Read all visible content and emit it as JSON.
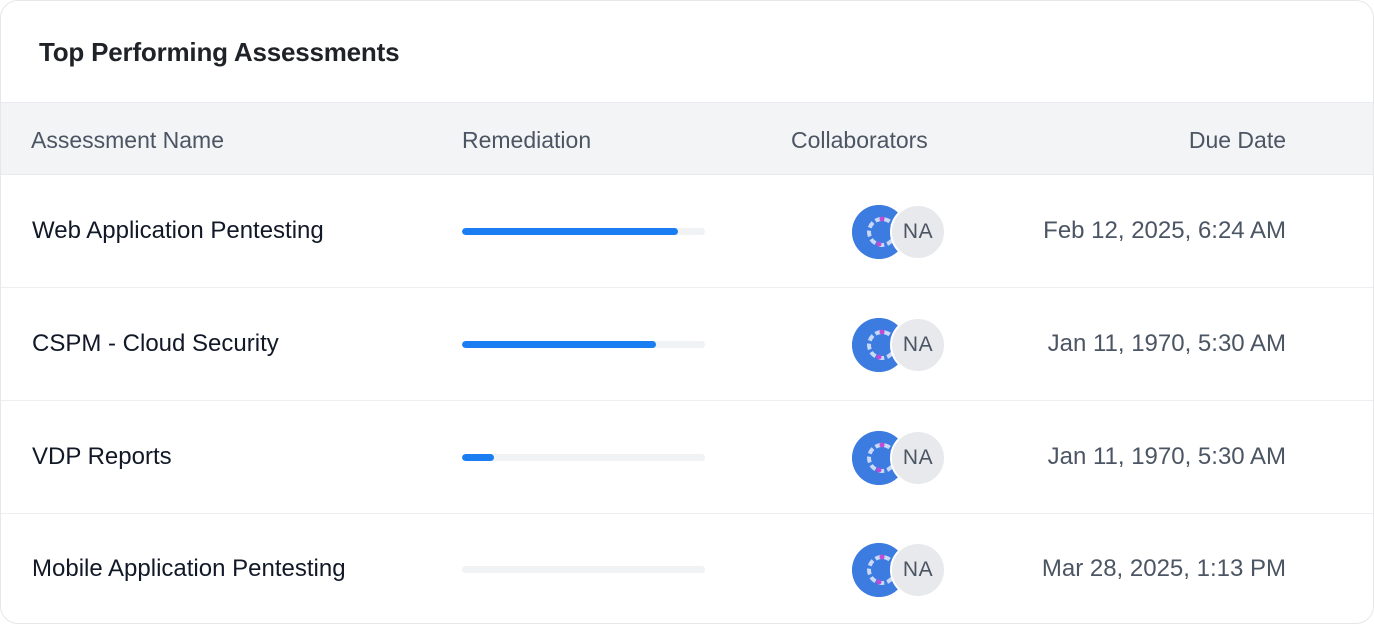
{
  "widget": {
    "title": "Top Performing Assessments"
  },
  "table": {
    "headers": {
      "name": "Assessment Name",
      "remediation": "Remediation",
      "collaborators": "Collaborators",
      "due_date": "Due Date"
    },
    "rows": [
      {
        "name": "Web Application Pentesting",
        "remediation_fraction": 0.89,
        "collaborator_initials": "NA",
        "due_date": "Feb 12, 2025, 6:24 AM"
      },
      {
        "name": "CSPM - Cloud Security",
        "remediation_fraction": 0.8,
        "collaborator_initials": "NA",
        "due_date": "Jan 11, 1970, 5:30 AM"
      },
      {
        "name": "VDP Reports",
        "remediation_fraction": 0.13,
        "collaborator_initials": "NA",
        "due_date": "Jan 11, 1970, 5:30 AM"
      },
      {
        "name": "Mobile Application Pentesting",
        "remediation_fraction": 0,
        "collaborator_initials": "NA",
        "due_date": "Mar 28, 2025, 1:13 PM"
      }
    ]
  },
  "colors": {
    "progress_fill": "#1a7ef2",
    "progress_track": "#f1f2f4",
    "header_bg": "#f3f4f6",
    "avatar_image_bg": "#3c7be0",
    "avatar_initials_bg": "#e8e9ec"
  },
  "icons": {
    "avatar_image": "user-avatar-icon"
  }
}
